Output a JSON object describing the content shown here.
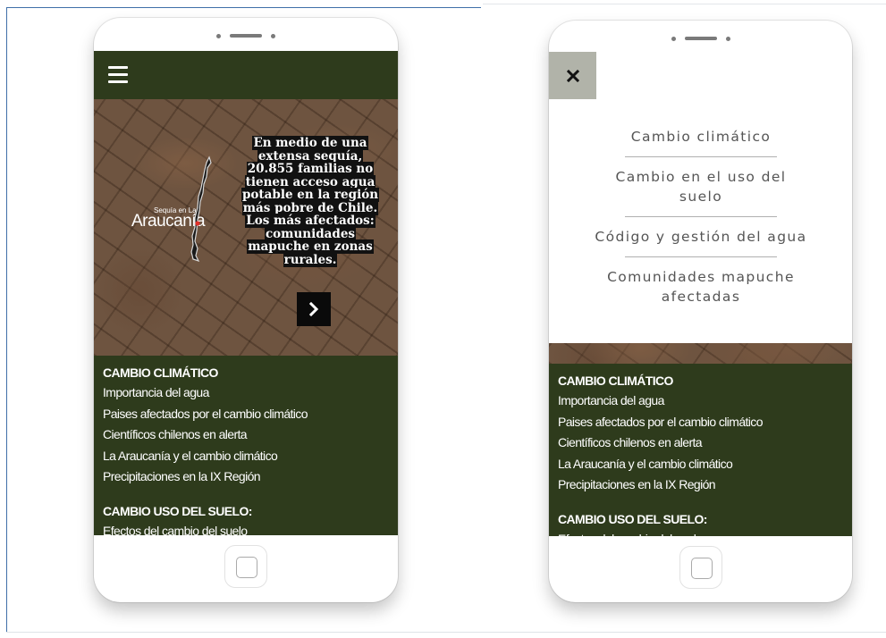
{
  "hero": {
    "logo_small": "Sequía en La",
    "logo_big": "Araucanía",
    "lines": [
      "En medio de una",
      "extensa sequía,",
      "20.855 familias no",
      "tienen acceso agua",
      "potable en la región",
      "más pobre de Chile.",
      "Los más afectados:",
      "comunidades",
      "mapuche en zonas",
      "rurales."
    ],
    "next_icon": "chevron-right-icon"
  },
  "sections": {
    "climate_title": "CAMBIO CLIMÁTICO",
    "climate_items": [
      "Importancia del agua",
      "Paises afectados por el cambio climático",
      "Científicos chilenos en alerta",
      "La Araucanía y el cambio climático",
      "Precipitaciones en la IX Región"
    ],
    "land_title": "CAMBIO USO DEL SUELO:",
    "land_items": [
      "Efectos  del cambio del suelo"
    ]
  },
  "menu": {
    "close_icon": "close-icon",
    "items": [
      "Cambio climático",
      "Cambio en el uso del suelo",
      "Código y gestión del agua",
      "Comunidades mapuche afectadas"
    ]
  },
  "colors": {
    "dark_green": "#2e3b1c",
    "close_bg": "#b1b3a9",
    "menu_text": "#555555"
  }
}
